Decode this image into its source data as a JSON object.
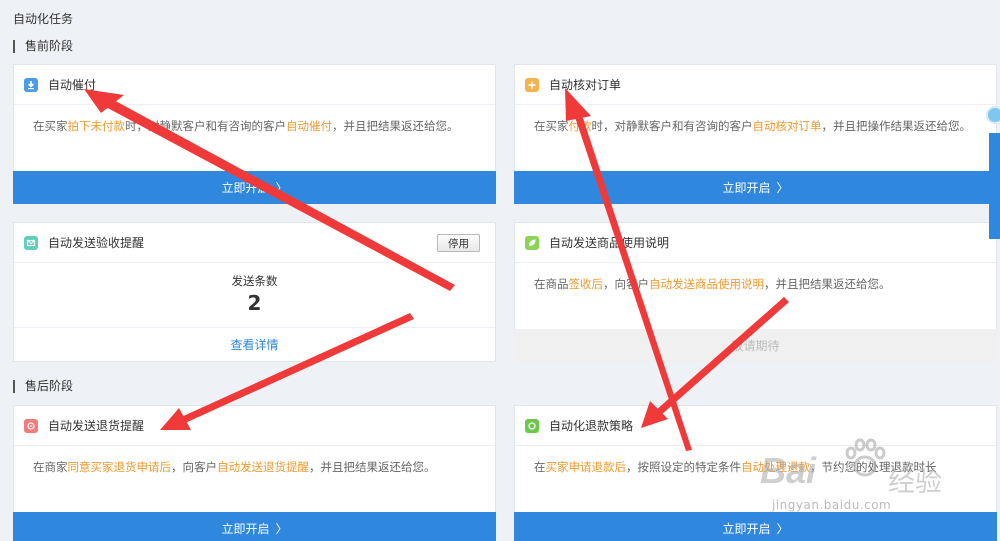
{
  "page_title": "自动化任务",
  "sections": {
    "presale": "售前阶段",
    "aftersale": "售后阶段"
  },
  "cards": {
    "auto_urge": {
      "title": "自动催付",
      "icon": "download-icon",
      "icon_color": "#4a9be8",
      "desc": [
        "在买家",
        "拍下未付款",
        "时，对静默客户和有咨询的客户",
        "自动催付",
        "，并且把结果返还给您。"
      ],
      "button": "立即开启"
    },
    "auto_check_order": {
      "title": "自动核对订单",
      "icon": "plus-icon",
      "icon_color": "#f5b34f",
      "desc": [
        "在买家",
        "付款",
        "时，对静默客户和有咨询的客户",
        "自动核对订单",
        "，并且把操作结果返还给您。"
      ],
      "button": "立即开启"
    },
    "auto_receipt_reminder": {
      "title": "自动发送验收提醒",
      "icon": "mail-icon",
      "icon_color": "#5fcfb8",
      "stop_button": "停用",
      "count_label": "发送条数",
      "count_value": "2",
      "detail_link": "查看详情"
    },
    "auto_usage_guide": {
      "title": "自动发送商品使用说明",
      "icon": "leaf-icon",
      "icon_color": "#8cd35a",
      "desc": [
        "在商品",
        "签收后",
        "，向客户",
        "自动发送商品使用说明",
        "，并且把结果返还给您。"
      ],
      "button": "敬请期待"
    },
    "auto_return_reminder": {
      "title": "自动发送退货提醒",
      "icon": "return-icon",
      "icon_color": "#f27b7b",
      "desc": [
        "在商家",
        "同意买家退货申请后",
        "，向客户",
        "自动发送退货提醒",
        "，并且把结果返还给您。"
      ],
      "button": "立即开启"
    },
    "auto_refund_policy": {
      "title": "自动化退款策略",
      "icon": "refund-icon",
      "icon_color": "#6cc94d",
      "desc": [
        "在",
        "买家申请退款后",
        "，按照设定的特定条件",
        "自动处理退款",
        "，节约您的处理退款时长"
      ],
      "button": "立即开启"
    }
  },
  "watermark": {
    "brand": "Bai",
    "brand_tail": "经验",
    "url": "jingyan.baidu.com"
  },
  "colors": {
    "primary": "#2f88de",
    "highlight": "#f39a2e",
    "arrow": "#f03a3a"
  }
}
